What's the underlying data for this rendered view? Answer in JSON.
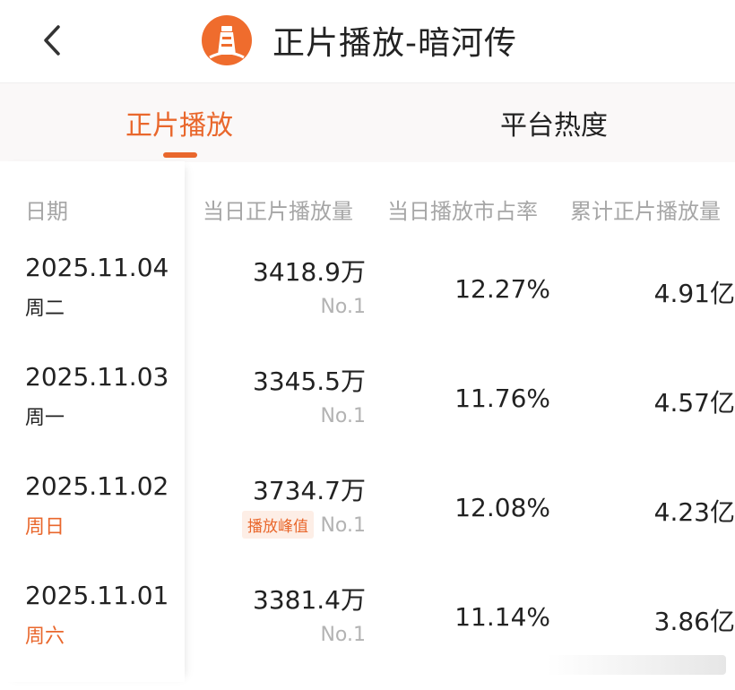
{
  "header": {
    "title": "正片播放-暗河传",
    "back_icon": "chevron-left-icon",
    "logo_icon": "lighthouse-logo-icon"
  },
  "tabs": [
    {
      "label": "正片播放",
      "active": true
    },
    {
      "label": "平台热度",
      "active": false
    }
  ],
  "table": {
    "columns": [
      "日期",
      "当日正片播放量",
      "当日播放市占率",
      "累计正片播放量"
    ],
    "rows": [
      {
        "date": "2025.11.04",
        "weekday": "周二",
        "weekday_highlight": false,
        "plays": "3418.9万",
        "rank": "No.1",
        "badge": "",
        "share": "12.27%",
        "cumulative": "4.91亿"
      },
      {
        "date": "2025.11.03",
        "weekday": "周一",
        "weekday_highlight": false,
        "plays": "3345.5万",
        "rank": "No.1",
        "badge": "",
        "share": "11.76%",
        "cumulative": "4.57亿"
      },
      {
        "date": "2025.11.02",
        "weekday": "周日",
        "weekday_highlight": true,
        "plays": "3734.7万",
        "rank": "No.1",
        "badge": "播放峰值",
        "share": "12.08%",
        "cumulative": "4.23亿"
      },
      {
        "date": "2025.11.01",
        "weekday": "周六",
        "weekday_highlight": true,
        "plays": "3381.4万",
        "rank": "No.1",
        "badge": "",
        "share": "11.14%",
        "cumulative": "3.86亿"
      }
    ]
  },
  "colors": {
    "accent": "#e9672c",
    "text": "#222222",
    "muted": "#a6a6a6"
  }
}
